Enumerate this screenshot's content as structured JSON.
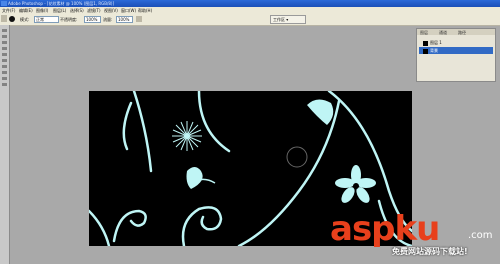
{
  "titlebar": {
    "title": "Adobe Photoshop - [花纹素材 @ 100% (图层1, RGB/8)]"
  },
  "menubar": {
    "items": [
      "文件(F)",
      "编辑(E)",
      "图像(I)",
      "图层(L)",
      "选择(S)",
      "滤镜(T)",
      "视图(V)",
      "窗口(W)",
      "帮助(H)"
    ]
  },
  "options": {
    "brush_label": "画笔:",
    "mode_label": "模式:",
    "mode_value": "正常",
    "opacity_label": "不透明度:",
    "opacity_value": "100%",
    "flow_label": "流量:",
    "flow_value": "100%",
    "workspace_label": "工作区 ▾"
  },
  "layers_panel": {
    "tabs": [
      "图层",
      "通道",
      "路径"
    ],
    "rows": [
      {
        "label": "图层 1",
        "selected": false
      },
      {
        "label": "背景",
        "selected": true
      }
    ]
  },
  "canvas": {
    "background_color": "#000000",
    "ornament_color": "#bff5f5"
  },
  "watermark": {
    "main": "aspku",
    "tld": ".com",
    "sub": "免费网站源码下载站!",
    "color": "#e8401c"
  }
}
